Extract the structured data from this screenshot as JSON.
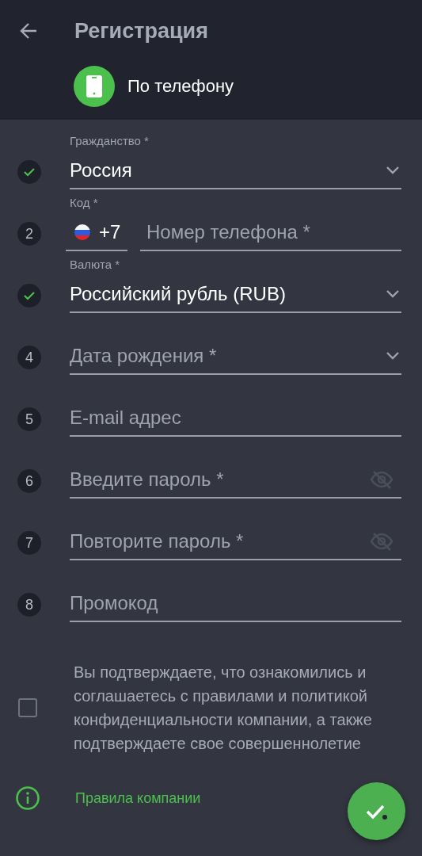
{
  "header": {
    "title": "Регистрация",
    "method": "По телефону"
  },
  "fields": [
    {
      "kind": "select",
      "done": true,
      "label": "Гражданство *",
      "value": "Россия"
    },
    {
      "kind": "phone",
      "done": false,
      "step": "2",
      "label": "Код *",
      "code": "+7",
      "placeholder": "Номер телефона *"
    },
    {
      "kind": "select",
      "done": true,
      "label": "Валюта *",
      "value": "Российский рубль (RUB)"
    },
    {
      "kind": "select",
      "done": false,
      "step": "4",
      "placeholder": "Дата рождения *"
    },
    {
      "kind": "text",
      "done": false,
      "step": "5",
      "placeholder": "E-mail адрес"
    },
    {
      "kind": "password",
      "done": false,
      "step": "6",
      "placeholder": "Введите пароль *"
    },
    {
      "kind": "password",
      "done": false,
      "step": "7",
      "placeholder": "Повторите пароль *"
    },
    {
      "kind": "text",
      "done": false,
      "step": "8",
      "placeholder": "Промокод"
    }
  ],
  "consent": {
    "checked": false,
    "text": "Вы подтверждаете, что ознакомились и соглашаетесь с правилами и политикой конфиденциальности компании, а также подтверждаете свое совершеннолетие"
  },
  "rules_link": "Правила компании"
}
